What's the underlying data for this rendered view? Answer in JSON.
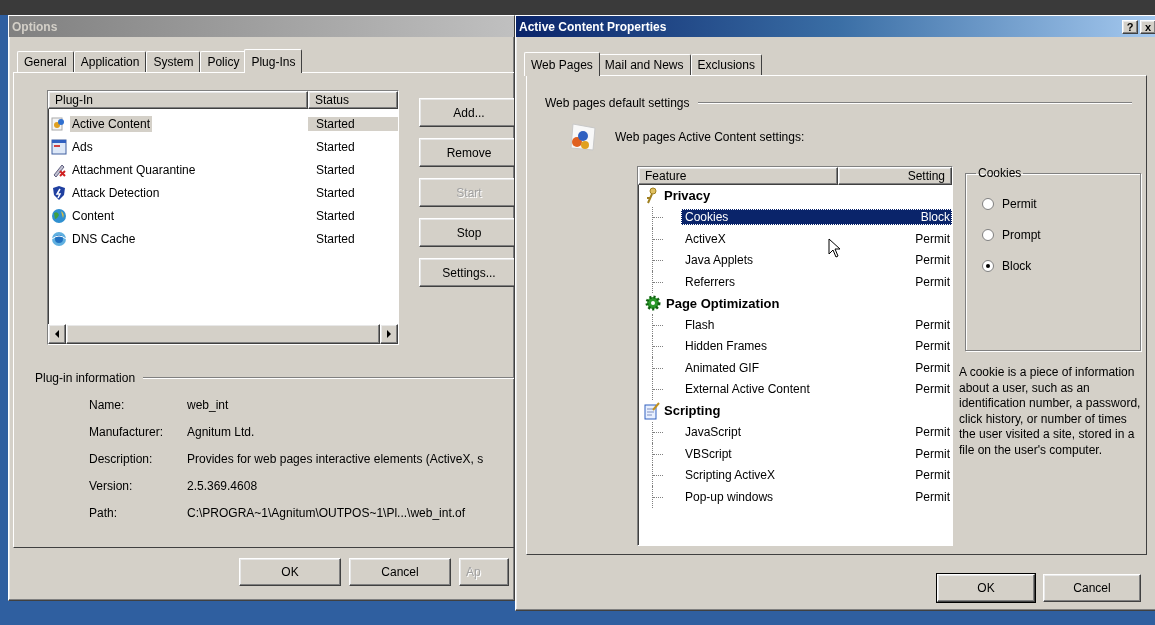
{
  "options_window": {
    "title": "Options",
    "active": false,
    "tabs": [
      {
        "label": "General",
        "selected": false
      },
      {
        "label": "Application",
        "selected": false
      },
      {
        "label": "System",
        "selected": false
      },
      {
        "label": "Policy",
        "selected": false
      },
      {
        "label": "Plug-Ins",
        "selected": true
      }
    ],
    "plugin_list": {
      "columns": [
        "Plug-In",
        "Status"
      ],
      "rows": [
        {
          "name": "Active Content",
          "status": "Started",
          "kind": "shapes",
          "selected": true
        },
        {
          "name": "Ads",
          "status": "Started",
          "kind": "window",
          "selected": false
        },
        {
          "name": "Attachment Quarantine",
          "status": "Started",
          "kind": "clip",
          "selected": false
        },
        {
          "name": "Attack Detection",
          "status": "Started",
          "kind": "shield",
          "selected": false
        },
        {
          "name": "Content",
          "status": "Started",
          "kind": "globe",
          "selected": false
        },
        {
          "name": "DNS Cache",
          "status": "Started",
          "kind": "globe-ring",
          "selected": false
        }
      ]
    },
    "side_buttons": [
      {
        "label": "Add...",
        "disabled": false
      },
      {
        "label": "Remove",
        "disabled": false
      },
      {
        "label": "Start",
        "disabled": true
      },
      {
        "label": "Stop",
        "disabled": false
      },
      {
        "label": "Settings...",
        "disabled": false
      }
    ],
    "info": {
      "title": "Plug-in information",
      "fields": [
        {
          "label": "Name:",
          "value": "web_int"
        },
        {
          "label": "Manufacturer:",
          "value": "Agnitum Ltd."
        },
        {
          "label": "Description:",
          "value": "Provides for web pages interactive elements (ActiveX, s"
        },
        {
          "label": "Version:",
          "value": "2.5.369.4608"
        },
        {
          "label": "Path:",
          "value": "C:\\PROGRA~1\\Agnitum\\OUTPOS~1\\Pl...\\web_int.of"
        }
      ]
    },
    "buttons": [
      {
        "label": "OK",
        "disabled": false
      },
      {
        "label": "Cancel",
        "disabled": false
      },
      {
        "label": "Ap",
        "disabled": true
      }
    ]
  },
  "properties_window": {
    "title": "Active Content Properties",
    "active": true,
    "title_buttons": [
      "?",
      "x"
    ],
    "tabs": [
      {
        "label": "Web Pages",
        "selected": true
      },
      {
        "label": "Mail and News",
        "selected": false
      },
      {
        "label": "Exclusions",
        "selected": false
      }
    ],
    "section_title": "Web pages default settings",
    "settings_label": "Web pages Active Content settings:",
    "tree": {
      "columns": [
        "Feature",
        "Setting"
      ],
      "groups": [
        {
          "label": "Privacy",
          "kind": "key",
          "children": [
            {
              "label": "Cookies",
              "setting": "Block",
              "selected": true
            },
            {
              "label": "ActiveX",
              "setting": "Permit",
              "selected": false
            },
            {
              "label": "Java Applets",
              "setting": "Permit",
              "selected": false
            },
            {
              "label": "Referrers",
              "setting": "Permit",
              "selected": false
            }
          ]
        },
        {
          "label": "Page Optimization",
          "kind": "gear",
          "children": [
            {
              "label": "Flash",
              "setting": "Permit",
              "selected": false
            },
            {
              "label": "Hidden Frames",
              "setting": "Permit",
              "selected": false
            },
            {
              "label": "Animated GIF",
              "setting": "Permit",
              "selected": false
            },
            {
              "label": "External Active Content",
              "setting": "Permit",
              "selected": false
            }
          ]
        },
        {
          "label": "Scripting",
          "kind": "script",
          "children": [
            {
              "label": "JavaScript",
              "setting": "Permit",
              "selected": false
            },
            {
              "label": "VBScript",
              "setting": "Permit",
              "selected": false
            },
            {
              "label": "Scripting ActiveX",
              "setting": "Permit",
              "selected": false
            },
            {
              "label": "Pop-up windows",
              "setting": "Permit",
              "selected": false
            }
          ]
        }
      ]
    },
    "choice": {
      "title": "Cookies",
      "options": [
        {
          "label": "Permit",
          "selected": false
        },
        {
          "label": "Prompt",
          "selected": false
        },
        {
          "label": "Block",
          "selected": true
        }
      ]
    },
    "description": "A cookie is a piece of information about a user, such as an identification number, a password, click history, or number of times the user visited a site, stored in a file on the user's computer.",
    "buttons": [
      {
        "label": "OK",
        "default": true
      },
      {
        "label": "Cancel",
        "default": false
      }
    ]
  }
}
